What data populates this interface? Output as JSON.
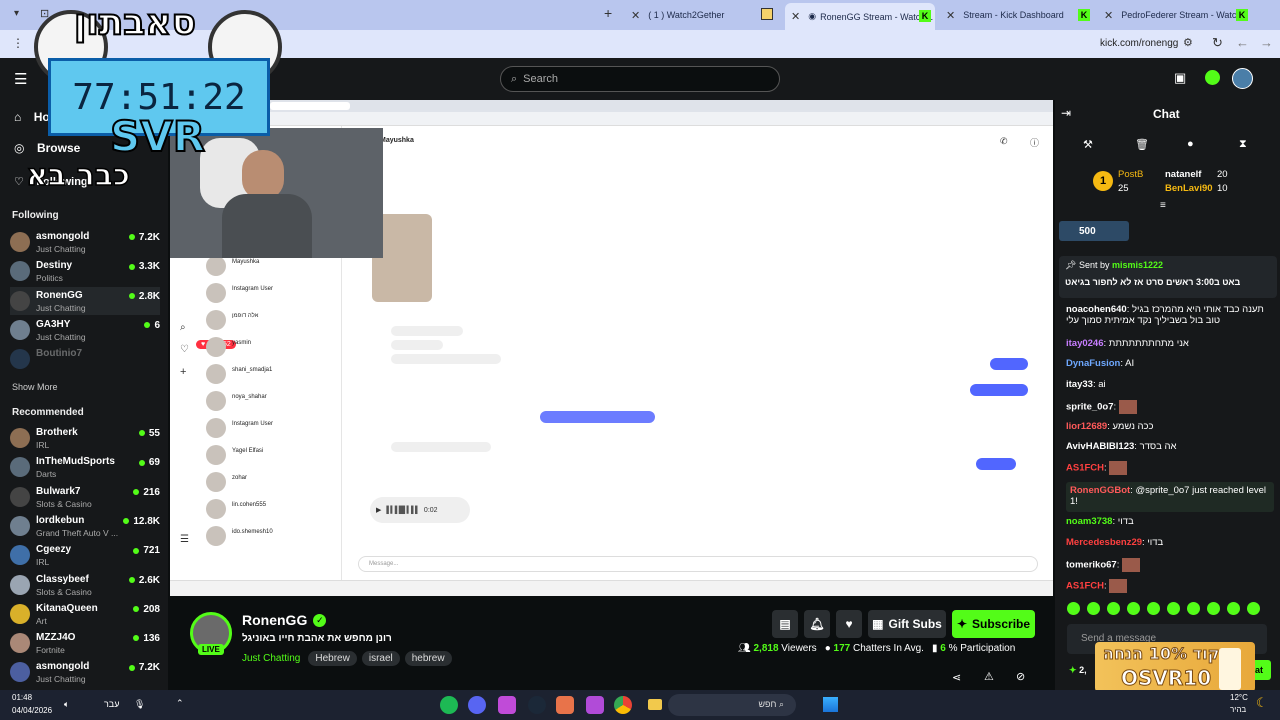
{
  "browser": {
    "tabs": [
      {
        "label": "( 1 ) Watch2Gether"
      },
      {
        "label": "RonenGG Stream - Watch L"
      },
      {
        "label": "Stream - Kick Dashboard"
      },
      {
        "label": "PedroFederer Stream - Watch L"
      }
    ],
    "url": "kick.com/ronengg"
  },
  "header": {
    "search_placeholder": "Search"
  },
  "overlay": {
    "timer": "77:51:22",
    "code": "SVR",
    "brand_top": "סאבתון",
    "brand_left": "כבר בא"
  },
  "sidebar": {
    "home": "Home",
    "browse": "Browse",
    "following_nav": "Following",
    "following_title": "Following",
    "following": [
      {
        "name": "asmongold",
        "category": "Just Chatting",
        "viewers": "7.2K"
      },
      {
        "name": "Destiny",
        "category": "Politics",
        "viewers": "3.3K"
      },
      {
        "name": "RonenGG",
        "category": "Just Chatting",
        "viewers": "2.8K"
      },
      {
        "name": "GA3HY",
        "category": "Just Chatting",
        "viewers": "6"
      },
      {
        "name": "Boutinio7",
        "category": "",
        "viewers": ""
      }
    ],
    "show_more": "Show More",
    "recommended_title": "Recommended",
    "recommended": [
      {
        "name": "Brotherk",
        "category": "IRL",
        "viewers": "55"
      },
      {
        "name": "InTheMudSports",
        "category": "Darts",
        "viewers": "69"
      },
      {
        "name": "Bulwark7",
        "category": "Slots & Casino",
        "viewers": "216"
      },
      {
        "name": "lordkebun",
        "category": "Grand Theft Auto V ...",
        "viewers": "12.8K"
      },
      {
        "name": "Cgeezy",
        "category": "IRL",
        "viewers": "721"
      },
      {
        "name": "Classybeef",
        "category": "Slots & Casino",
        "viewers": "2.6K"
      },
      {
        "name": "KitanaQueen",
        "category": "Art",
        "viewers": "208"
      },
      {
        "name": "MZZJ4O",
        "category": "Fortnite",
        "viewers": "136"
      },
      {
        "name": "asmongold",
        "category": "Just Chatting",
        "viewers": "7.2K"
      }
    ]
  },
  "stream": {
    "channel": "RonenGG",
    "title": "רונן מחפש את אהבת חייו באוניגל",
    "category": "Just Chatting",
    "tags": [
      "Hebrew",
      "israel",
      "hebrew"
    ],
    "live_badge": "LIVE",
    "gift_subs": "Gift Subs",
    "subscribe": "Subscribe",
    "viewers": "2,818",
    "viewers_label": "Viewers",
    "chatters": "177",
    "chatters_label": "Chatters In Avg.",
    "participation": "6",
    "participation_label": "% Participation"
  },
  "inner_screen": {
    "contact": "Mayushka",
    "dm_list": [
      {
        "name": "Mayushka"
      },
      {
        "name": "Instagram User"
      },
      {
        "name": "אלה דופמן"
      },
      {
        "name": "yasmin"
      },
      {
        "name": "shani_smadja1"
      },
      {
        "name": "noya_shahar"
      },
      {
        "name": "Instagram User"
      },
      {
        "name": "Yagel Elfasi"
      },
      {
        "name": "zohar"
      },
      {
        "name": "lin.cohen555"
      },
      {
        "name": "ido.shemesh10"
      }
    ],
    "message_placeholder": "Message...",
    "audio_time": "0:02",
    "notif_count_a": "27",
    "notif_count_b": "52"
  },
  "chat": {
    "title": "Chat",
    "leaderboard": [
      {
        "name": "PostB",
        "value": "25"
      },
      {
        "name": "natanelf",
        "value": "20"
      },
      {
        "name": "BenLavi90",
        "value": "10"
      }
    ],
    "gift_count": "500",
    "pinned_by_label": "Sent by",
    "pinned_user": "mismis1222",
    "pinned_text": "באט ב3:00 ראשים סרט אז לא לחפור בגיאט",
    "messages": [
      {
        "user": "noacohen640",
        "text": "תענה כבד אותי היא מהמרכז בגיל טוב בול בשביליך נקד אמיתית סמוך עלי"
      },
      {
        "user": "itay0246",
        "text": "אני מתחתתתתתתת"
      },
      {
        "user": "DynaFusion",
        "text": "AI"
      },
      {
        "user": "itay33",
        "text": "ai"
      },
      {
        "user": "sprite_0o7",
        "text": ""
      },
      {
        "user": "lior12689",
        "text": "ככה נשמע"
      },
      {
        "user": "AvivHABIBI123",
        "text": "אה בסדר"
      },
      {
        "user": "AS1FCH",
        "text": ""
      },
      {
        "user": "RonenGGBot",
        "text": "@sprite_0o7 just reached level 1!"
      },
      {
        "user": "noam3738",
        "text": "בדוי"
      },
      {
        "user": "Mercedesbenz29",
        "text": "בדוי"
      },
      {
        "user": "tomeriko67",
        "text": ""
      },
      {
        "user": "AS1FCH",
        "text": ""
      }
    ],
    "send_placeholder": "Send a message",
    "chat_button": "Chat",
    "points": "2,"
  },
  "promo": {
    "line1": "קוד 10% הנחה",
    "code": "OSVR10"
  },
  "taskbar": {
    "time": "01:48",
    "date": "04/04/2026",
    "lang": "עבר",
    "search": "חפש",
    "weather": "12°C",
    "weather_desc": "בהיר"
  }
}
